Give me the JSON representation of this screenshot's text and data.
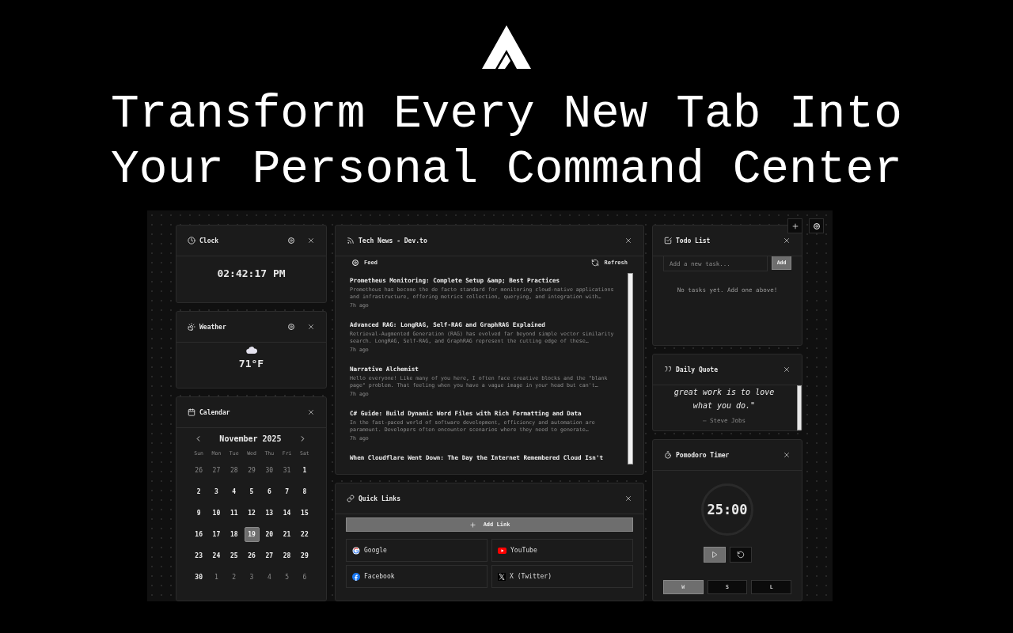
{
  "hero": {
    "headline_lines": [
      "Transform Every New Tab Into",
      "Your Personal Command Center"
    ]
  },
  "dashboard": {
    "columns": [
      {
        "widgets": [
          {
            "kind": "clock",
            "title": "Clock",
            "time": "02:42:17 PM"
          },
          {
            "kind": "weather",
            "title": "Weather",
            "temperature": "71°F"
          },
          {
            "kind": "calendar",
            "title": "Calendar",
            "month": "November 2025",
            "weekdays": [
              "Sun",
              "Mon",
              "Tue",
              "Wed",
              "Thu",
              "Fri",
              "Sat"
            ],
            "weeks": [
              [
                {
                  "day": "26",
                  "muted": true,
                  "selected": false
                },
                {
                  "day": "27",
                  "muted": true,
                  "selected": false
                },
                {
                  "day": "28",
                  "muted": true,
                  "selected": false
                },
                {
                  "day": "29",
                  "muted": true,
                  "selected": false
                },
                {
                  "day": "30",
                  "muted": true,
                  "selected": false
                },
                {
                  "day": "31",
                  "muted": true,
                  "selected": false
                },
                {
                  "day": "1",
                  "muted": false,
                  "selected": false
                }
              ],
              [
                {
                  "day": "2",
                  "muted": false,
                  "selected": false
                },
                {
                  "day": "3",
                  "muted": false,
                  "selected": false
                },
                {
                  "day": "4",
                  "muted": false,
                  "selected": false
                },
                {
                  "day": "5",
                  "muted": false,
                  "selected": false
                },
                {
                  "day": "6",
                  "muted": false,
                  "selected": false
                },
                {
                  "day": "7",
                  "muted": false,
                  "selected": false
                },
                {
                  "day": "8",
                  "muted": false,
                  "selected": false
                }
              ],
              [
                {
                  "day": "9",
                  "muted": false,
                  "selected": false
                },
                {
                  "day": "10",
                  "muted": false,
                  "selected": false
                },
                {
                  "day": "11",
                  "muted": false,
                  "selected": false
                },
                {
                  "day": "12",
                  "muted": false,
                  "selected": false
                },
                {
                  "day": "13",
                  "muted": false,
                  "selected": false
                },
                {
                  "day": "14",
                  "muted": false,
                  "selected": false
                },
                {
                  "day": "15",
                  "muted": false,
                  "selected": false
                }
              ],
              [
                {
                  "day": "16",
                  "muted": false,
                  "selected": false
                },
                {
                  "day": "17",
                  "muted": false,
                  "selected": false
                },
                {
                  "day": "18",
                  "muted": false,
                  "selected": false
                },
                {
                  "day": "19",
                  "muted": false,
                  "selected": true
                },
                {
                  "day": "20",
                  "muted": false,
                  "selected": false
                },
                {
                  "day": "21",
                  "muted": false,
                  "selected": false
                },
                {
                  "day": "22",
                  "muted": false,
                  "selected": false
                }
              ],
              [
                {
                  "day": "23",
                  "muted": false,
                  "selected": false
                },
                {
                  "day": "24",
                  "muted": false,
                  "selected": false
                },
                {
                  "day": "25",
                  "muted": false,
                  "selected": false
                },
                {
                  "day": "26",
                  "muted": false,
                  "selected": false
                },
                {
                  "day": "27",
                  "muted": false,
                  "selected": false
                },
                {
                  "day": "28",
                  "muted": false,
                  "selected": false
                },
                {
                  "day": "29",
                  "muted": false,
                  "selected": false
                }
              ],
              [
                {
                  "day": "30",
                  "muted": false,
                  "selected": false
                },
                {
                  "day": "1",
                  "muted": true,
                  "selected": false
                },
                {
                  "day": "2",
                  "muted": true,
                  "selected": false
                },
                {
                  "day": "3",
                  "muted": true,
                  "selected": false
                },
                {
                  "day": "4",
                  "muted": true,
                  "selected": false
                },
                {
                  "day": "5",
                  "muted": true,
                  "selected": false
                },
                {
                  "day": "6",
                  "muted": true,
                  "selected": false
                }
              ]
            ]
          }
        ]
      },
      {
        "widgets": [
          {
            "kind": "news",
            "title": "Tech News - Dev.to",
            "feed_label": "Feed",
            "refresh_label": "Refresh",
            "articles": [
              {
                "title": "Prometheus Monitoring: Complete Setup &amp; Best Practices",
                "summary": "Prometheus has become the de facto standard for monitoring cloud-native applications and infrastructure, offering metrics collection, querying, and integration with…",
                "age": "7h ago"
              },
              {
                "title": "Advanced RAG: LongRAG, Self-RAG and GraphRAG Explained",
                "summary": "Retrieval-Augmented Generation (RAG) has evolved far beyond simple vector similarity search. LongRAG, Self-RAG, and GraphRAG represent the cutting edge of these…",
                "age": "7h ago"
              },
              {
                "title": "Narrative Alchemist",
                "summary": "Hello everyone! Like many of you here, I often face creative blocks and the \"blank page\" problem. That feeling when you have a vague image in your head but can't…",
                "age": "7h ago"
              },
              {
                "title": "C# Guide: Build Dynamic Word Files with Rich Formatting and Data",
                "summary": "In the fast-paced world of software development, efficiency and automation are paramount. Developers often encounter scenarios where they need to generate…",
                "age": "7h ago"
              },
              {
                "title": "When Cloudflare Went Down: The Day the Internet Remembered Cloud Isn't"
              }
            ]
          },
          {
            "kind": "quick_links",
            "title": "Quick Links",
            "add_label": "Add Link",
            "links": [
              {
                "kind": "google",
                "label": "Google"
              },
              {
                "kind": "youtube",
                "label": "YouTube"
              },
              {
                "kind": "facebook",
                "label": "Facebook"
              },
              {
                "kind": "x",
                "label": "X (Twitter)"
              }
            ]
          }
        ]
      },
      {
        "widgets": [
          {
            "kind": "todo",
            "title": "Todo List",
            "placeholder": "Add a new task...",
            "add_label": "Add",
            "empty_text": "No tasks yet. Add one above!"
          },
          {
            "kind": "quote",
            "title": "Daily Quote",
            "text_lines": [
              "great work is to love",
              "what you do.\""
            ],
            "author": "— Steve Jobs"
          },
          {
            "kind": "pomodoro",
            "title": "Pomodoro Timer",
            "time": "25:00",
            "modes": [
              {
                "label": "W",
                "selected": true
              },
              {
                "label": "S",
                "selected": false
              },
              {
                "label": "L",
                "selected": false
              }
            ]
          }
        ]
      }
    ]
  }
}
